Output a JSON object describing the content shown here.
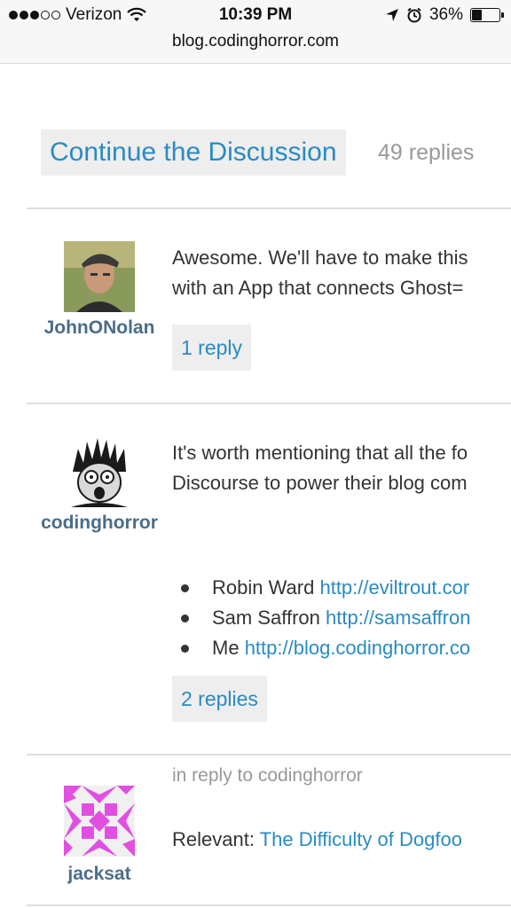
{
  "status_bar": {
    "carrier": "Verizon",
    "time": "10:39 PM",
    "battery_percent": "36%",
    "battery_level": 0.36
  },
  "address_bar": {
    "url": "blog.codinghorror.com"
  },
  "discussion": {
    "continue_label": "Continue the Discussion",
    "replies_label": "49 replies"
  },
  "posts": [
    {
      "username": "JohnONolan",
      "lines": [
        "Awesome. We'll have to make this",
        "with an App that connects Ghost="
      ],
      "reply_label": "1 reply"
    },
    {
      "username": "codinghorror",
      "lines": [
        "It's worth mentioning that all the fo",
        "Discourse to power their blog com"
      ],
      "bullets": [
        {
          "name": "Robin Ward",
          "link": "http://eviltrout.cor"
        },
        {
          "name": "Sam Saffron",
          "link": "http://samsaffron"
        },
        {
          "name": "Me",
          "link": "http://blog.codinghorror.co"
        }
      ],
      "reply_label": "2 replies"
    },
    {
      "username": "jacksat",
      "meta": "in reply to codinghorror",
      "text_prefix": "Relevant:",
      "text_link": "The Difficulty of Dogfoo"
    }
  ],
  "colors": {
    "link": "#2a8bc2",
    "username": "#4b6d8a",
    "muted": "#999999",
    "button_bg": "#eeeeee"
  }
}
